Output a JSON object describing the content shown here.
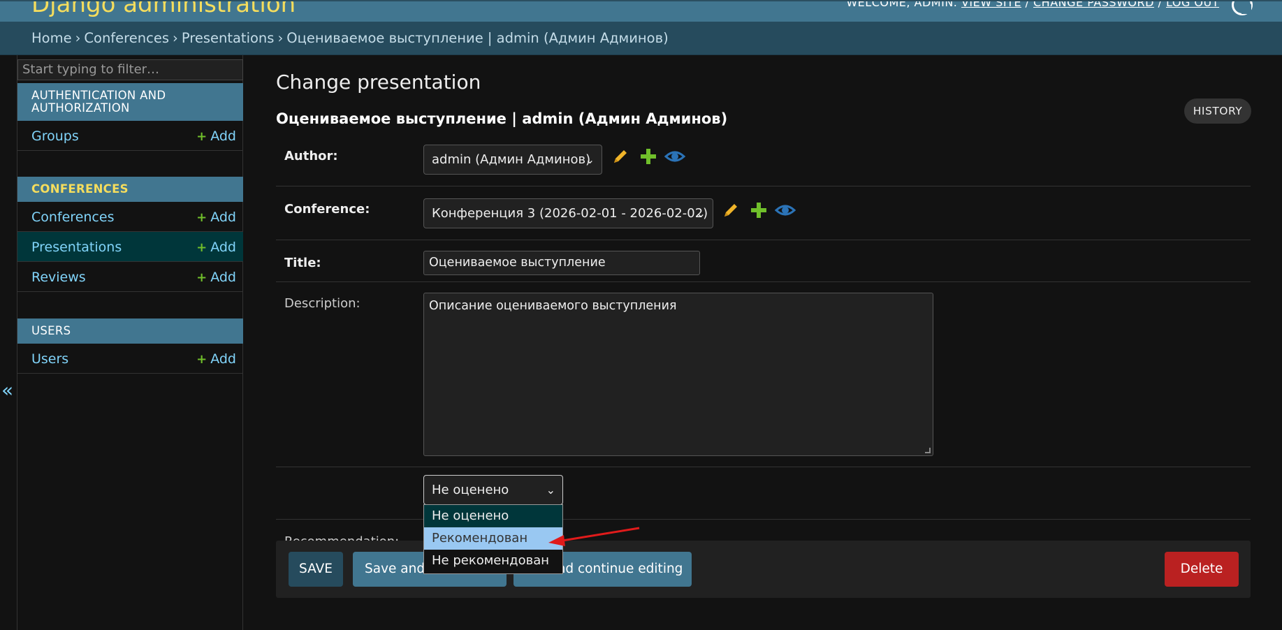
{
  "header": {
    "branding": "Django administration",
    "user_tools": {
      "welcome": "WELCOME, ADMIN.",
      "view_site": "VIEW SITE",
      "sep1": " / ",
      "change_password": "CHANGE PASSWORD",
      "sep2": " / ",
      "log_out": "LOG OUT"
    }
  },
  "breadcrumbs": {
    "home": "Home",
    "app": "Conferences",
    "model": "Presentations",
    "object": "Оцениваемое выступление | admin (Админ Админов)",
    "sep": "›"
  },
  "sidebar": {
    "collapse_glyph": "«",
    "filter_placeholder": "Start typing to filter…",
    "add_label": "Add",
    "modules": [
      {
        "caption": "AUTHENTICATION AND AUTHORIZATION",
        "rows": [
          {
            "label": "Groups"
          }
        ]
      },
      {
        "caption": "CONFERENCES",
        "rows": [
          {
            "label": "Conferences"
          },
          {
            "label": "Presentations"
          },
          {
            "label": "Reviews"
          }
        ]
      },
      {
        "caption": "USERS",
        "rows": [
          {
            "label": "Users"
          }
        ]
      }
    ]
  },
  "main": {
    "title": "Change presentation",
    "object_title": "Оцениваемое выступление | admin (Админ Админов)",
    "history_label": "HISTORY",
    "fields": {
      "author": {
        "label": "Author:",
        "value": "admin (Админ Админов)"
      },
      "conference": {
        "label": "Conference:",
        "value": "Конференция 3 (2026-02-01 - 2026-02-02)"
      },
      "title": {
        "label": "Title:",
        "value": "Оцениваемое выступление"
      },
      "description": {
        "label": "Description:",
        "value": "Описание оцениваемого выступления"
      },
      "recommendation": {
        "label": "Recommendation:",
        "value": "Не оценено",
        "options": [
          "Не оценено",
          "Рекомендован",
          "Не рекомендован"
        ],
        "highlighted_option": "Рекомендован"
      }
    },
    "buttons": {
      "save": "SAVE",
      "save_add": "Save and add another",
      "save_continue": "Save and continue editing",
      "delete": "Delete"
    }
  },
  "colors": {
    "header_bg": "#417690",
    "breadcrumbs_bg": "#264b5d",
    "branding": "#f5dd5d",
    "link": "#81d4fa",
    "add_plus": "#70bf2b",
    "change_pencil": "#f0b429",
    "view_eye": "#2b73b7",
    "delete_bg": "#ba2121",
    "annotation_arrow": "#e01b1b"
  }
}
